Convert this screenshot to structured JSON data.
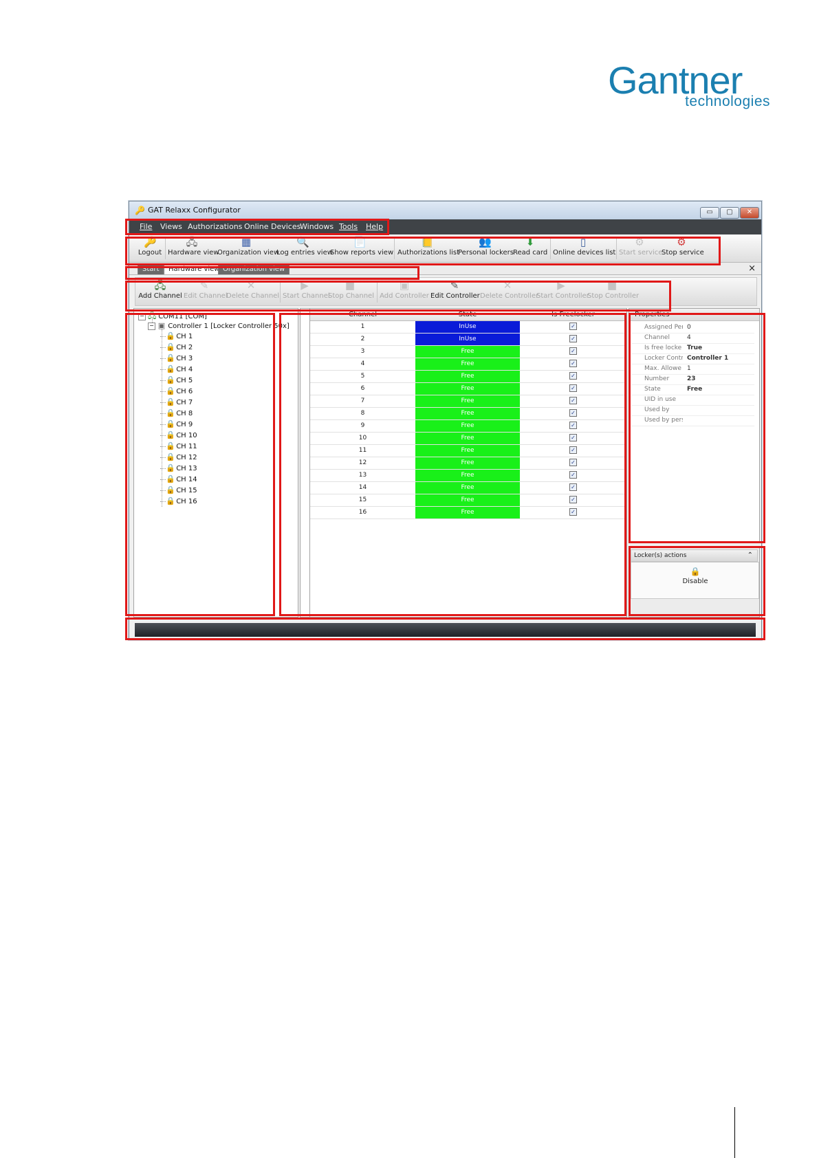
{
  "logo": {
    "brand": "Gantner",
    "sub": "technologies"
  },
  "window": {
    "title": "GAT Relaxx Configurator",
    "controls": {
      "minimize": "▭",
      "maximize": "▢",
      "close": "✕"
    }
  },
  "menu": [
    "File",
    "Views",
    "Authorizations",
    "Online Devices",
    "Windows",
    "Tools",
    "Help"
  ],
  "toolbar": [
    {
      "label": "Logout",
      "icon": "logout-icon",
      "glyph": "🔑",
      "enabled": true
    },
    {
      "label": "Hardware view",
      "icon": "hardware-view-icon",
      "glyph": "🖧",
      "enabled": true
    },
    {
      "label": "Organization view",
      "icon": "organization-view-icon",
      "glyph": "▦",
      "enabled": true
    },
    {
      "label": "Log entries view",
      "icon": "log-entries-icon",
      "glyph": "🔍",
      "enabled": true
    },
    {
      "label": "Show reports view",
      "icon": "reports-icon",
      "glyph": "📄",
      "enabled": true
    },
    {
      "label": "Authorizations list",
      "icon": "authorizations-list-icon",
      "glyph": "📒",
      "enabled": true
    },
    {
      "label": "Personal lockers",
      "icon": "personal-lockers-icon",
      "glyph": "👥",
      "enabled": true
    },
    {
      "label": "Read card",
      "icon": "read-card-icon",
      "glyph": "⬇",
      "enabled": true
    },
    {
      "label": "Online devices list",
      "icon": "online-devices-icon",
      "glyph": "▯",
      "enabled": true
    },
    {
      "label": "Start service",
      "icon": "start-service-icon",
      "glyph": "⚙",
      "enabled": false
    },
    {
      "label": "Stop service",
      "icon": "stop-service-icon",
      "glyph": "⚙",
      "enabled": true
    }
  ],
  "tabs": {
    "start": "Start",
    "hardware": "Hardware view",
    "organization": "Organization view",
    "close": "×"
  },
  "subtoolbar": [
    {
      "label": "Add Channel",
      "icon": "add-channel-icon",
      "glyph": "🖧",
      "enabled": true
    },
    {
      "label": "Edit Channel",
      "icon": "edit-channel-icon",
      "glyph": "✎",
      "enabled": false
    },
    {
      "label": "Delete Channel",
      "icon": "delete-channel-icon",
      "glyph": "✕",
      "enabled": false
    },
    {
      "label": "Start Channel",
      "icon": "start-channel-icon",
      "glyph": "▶",
      "enabled": false
    },
    {
      "label": "Stop Channel",
      "icon": "stop-channel-icon",
      "glyph": "■",
      "enabled": false
    },
    {
      "label": "Add Controller",
      "icon": "add-controller-icon",
      "glyph": "▣",
      "enabled": false
    },
    {
      "label": "Edit Controller",
      "icon": "edit-controller-icon",
      "glyph": "✎",
      "enabled": true
    },
    {
      "label": "Delete Controller",
      "icon": "delete-controller-icon",
      "glyph": "✕",
      "enabled": false
    },
    {
      "label": "Start Controller",
      "icon": "start-controller-icon",
      "glyph": "▶",
      "enabled": false
    },
    {
      "label": "Stop Controller",
      "icon": "stop-controller-icon",
      "glyph": "■",
      "enabled": false
    }
  ],
  "tree": {
    "root": "COM11 [COM]",
    "controller": "Controller 1 [Locker Controller 50x]",
    "channels": [
      "CH 1",
      "CH 2",
      "CH 3",
      "CH 4",
      "CH 5",
      "CH 6",
      "CH 7",
      "CH 8",
      "CH 9",
      "CH 10",
      "CH 11",
      "CH 12",
      "CH 13",
      "CH 14",
      "CH 15",
      "CH 16"
    ]
  },
  "grid": {
    "headers": [
      "Channel",
      "State",
      "Is Freelocker"
    ],
    "rows": [
      {
        "channel": "1",
        "state": "InUse",
        "freelocker": true
      },
      {
        "channel": "2",
        "state": "InUse",
        "freelocker": true
      },
      {
        "channel": "3",
        "state": "Free",
        "freelocker": true
      },
      {
        "channel": "4",
        "state": "Free",
        "freelocker": true
      },
      {
        "channel": "5",
        "state": "Free",
        "freelocker": true
      },
      {
        "channel": "6",
        "state": "Free",
        "freelocker": true
      },
      {
        "channel": "7",
        "state": "Free",
        "freelocker": true
      },
      {
        "channel": "8",
        "state": "Free",
        "freelocker": true
      },
      {
        "channel": "9",
        "state": "Free",
        "freelocker": true
      },
      {
        "channel": "10",
        "state": "Free",
        "freelocker": true
      },
      {
        "channel": "11",
        "state": "Free",
        "freelocker": true
      },
      {
        "channel": "12",
        "state": "Free",
        "freelocker": true
      },
      {
        "channel": "13",
        "state": "Free",
        "freelocker": true
      },
      {
        "channel": "14",
        "state": "Free",
        "freelocker": true
      },
      {
        "channel": "15",
        "state": "Free",
        "freelocker": true
      },
      {
        "channel": "16",
        "state": "Free",
        "freelocker": true
      }
    ]
  },
  "state_colors": {
    "InUse": "#0a1bd8",
    "Free": "#19f019"
  },
  "properties": {
    "title": "Properties",
    "rows": [
      {
        "name": "Assigned Per",
        "value": "0",
        "bold": false
      },
      {
        "name": "Channel",
        "value": "4",
        "bold": false
      },
      {
        "name": "Is free locke",
        "value": "True",
        "bold": true
      },
      {
        "name": "Locker Contr",
        "value": "Controller 1",
        "bold": true
      },
      {
        "name": "Max. Allowe",
        "value": "1",
        "bold": false
      },
      {
        "name": "Number",
        "value": "23",
        "bold": true
      },
      {
        "name": "State",
        "value": "Free",
        "bold": true
      },
      {
        "name": "UID in use",
        "value": "",
        "bold": false
      },
      {
        "name": "Used by",
        "value": "",
        "bold": false
      },
      {
        "name": "Used by pers",
        "value": "",
        "bold": false
      }
    ]
  },
  "actions": {
    "title": "Locker(s) actions",
    "collapse": "⌃",
    "button": "Disable",
    "button_icon": "lock-icon"
  },
  "highlight_color": "#e01818"
}
